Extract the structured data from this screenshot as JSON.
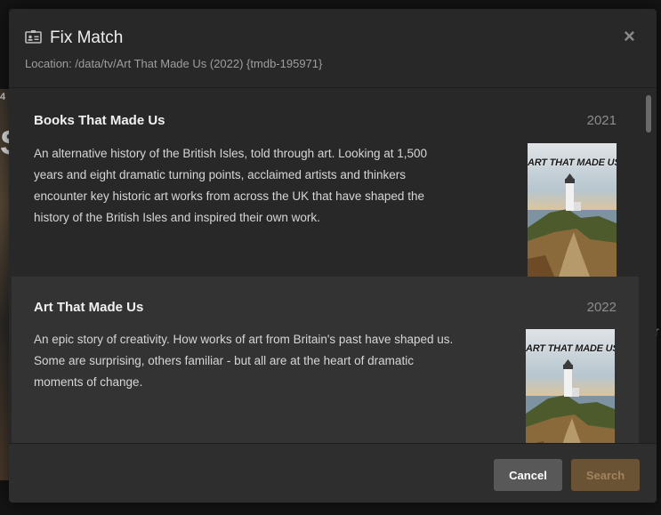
{
  "background": {
    "left_snippet": "4",
    "left_big": "S",
    "right_snippet": "r"
  },
  "modal": {
    "title": "Fix Match",
    "location": "Location: /data/tv/Art That Made Us (2022) {tmdb-195971}",
    "title_icon": "id-card-icon",
    "close_icon": "close-icon",
    "close_glyph": "×"
  },
  "results": [
    {
      "title": "Books That Made Us",
      "year": "2021",
      "description": "An alternative history of the British Isles, told through art. Looking at 1,500 years and eight dramatic turning points, acclaimed artists and thinkers encounter key historic art works from across the UK that have shaped the history of the British Isles and inspired their own work.",
      "poster_text": "ART THAT MADE US"
    },
    {
      "title": "Art That Made Us",
      "year": "2022",
      "description": "An epic story of creativity. How works of art from Britain's past have shaped us. Some are surprising, others familiar - but all are at the heart of dramatic moments of change.",
      "poster_text": "ART THAT MADE US"
    }
  ],
  "footer": {
    "cancel_label": "Cancel",
    "search_label": "Search"
  },
  "colors": {
    "modal_bg": "#282828",
    "selected_row_bg": "#333333",
    "search_button_bg": "#6a5335",
    "cancel_button_bg": "#585858"
  }
}
